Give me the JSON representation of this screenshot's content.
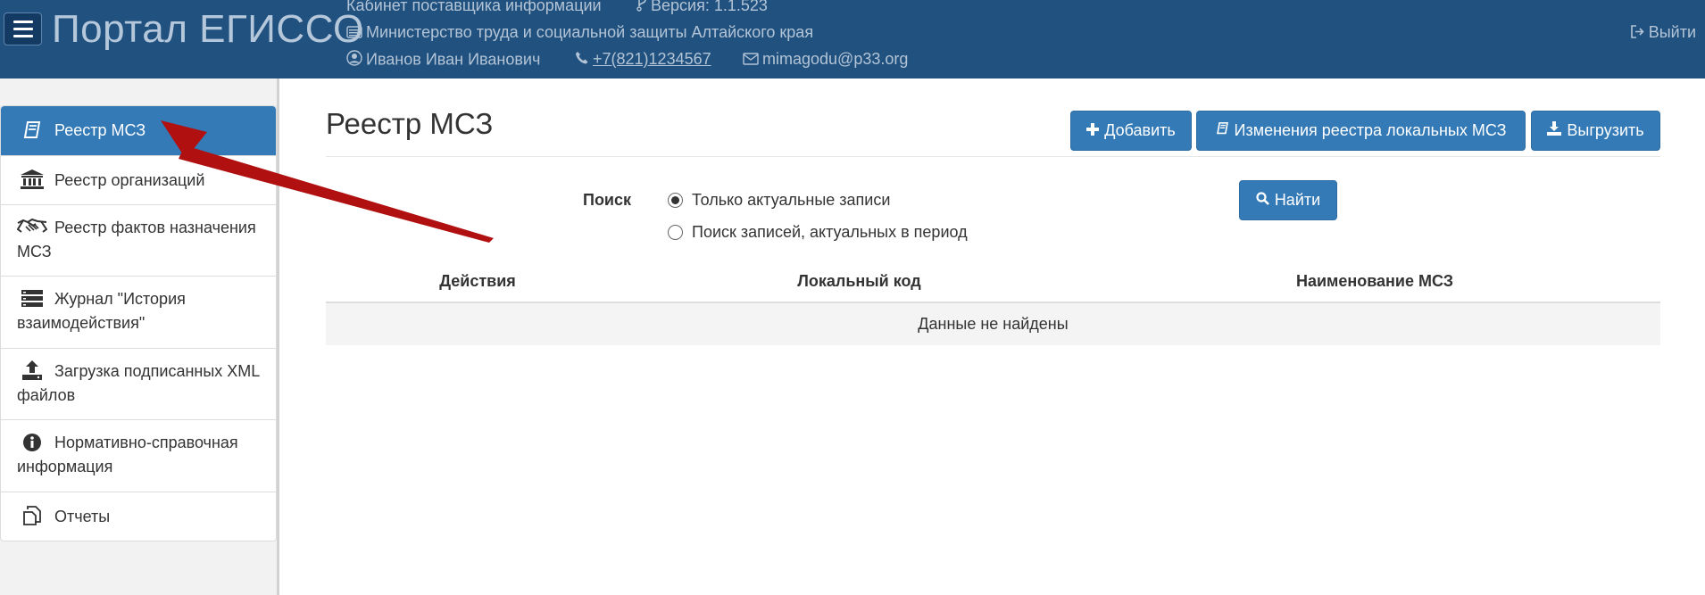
{
  "header": {
    "portal_title": "Портал ЕГИССО",
    "cabinet": "Кабинет поставщика информации",
    "version": "Версия: 1.1.523",
    "ministry": "Министерство труда и социальной защиты Алтайского края",
    "user": "Иванов Иван Иванович",
    "phone": "+7(821)1234567",
    "email": "mimagodu@p33.org",
    "logout": "Выйти"
  },
  "sidebar": {
    "items": [
      {
        "label": "Реестр МСЗ",
        "icon": "book-icon",
        "active": true
      },
      {
        "label": "Реестр организаций",
        "icon": "institution-icon"
      },
      {
        "label": "Реестр фактов назначения МСЗ",
        "icon": "handshake-icon"
      },
      {
        "label": "Журнал \"История взаимодействия\"",
        "icon": "list-icon"
      },
      {
        "label": "Загрузка подписанных XML файлов",
        "icon": "upload-icon"
      },
      {
        "label": "Нормативно-справочная информация",
        "icon": "info-icon"
      },
      {
        "label": "Отчеты",
        "icon": "copy-icon"
      }
    ]
  },
  "main": {
    "title": "Реестр МСЗ",
    "buttons": {
      "add": "Добавить",
      "changes": "Изменения реестра локальных МСЗ",
      "export": "Выгрузить",
      "find": "Найти"
    },
    "search": {
      "label": "Поиск",
      "option_current": "Только актуальные записи",
      "option_period": "Поиск записей, актуальных в период",
      "selected": "Только актуальные записи"
    },
    "table": {
      "columns": [
        "Действия",
        "Локальный код",
        "Наименование МСЗ"
      ],
      "empty_text": "Данные не найдены"
    }
  },
  "colors": {
    "header_bg": "#20517f",
    "primary": "#337ab7",
    "annotation_arrow": "#b01010"
  }
}
